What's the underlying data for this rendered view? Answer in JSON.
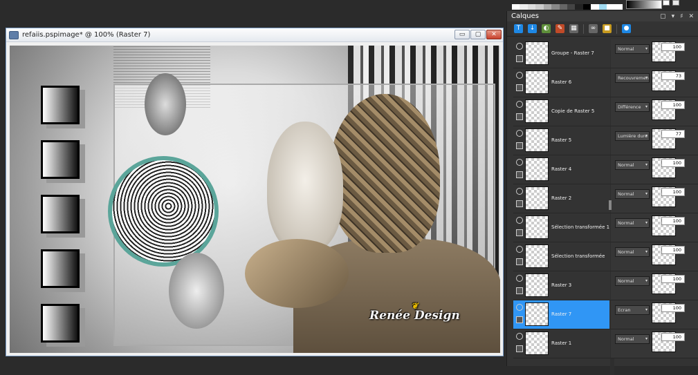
{
  "document_window": {
    "title": "refaiis.pspimage* @ 100% (Raster 7)",
    "buttons": {
      "minimize": "▭",
      "restore": "▢",
      "close": "✕"
    }
  },
  "watermark": {
    "text": "Renée Design",
    "bee": "❦"
  },
  "layers_panel": {
    "title": "Calques",
    "controls": [
      "▢",
      "▾",
      "♯",
      "✕"
    ],
    "toolbar_icons": [
      "new-raster-layer-icon",
      "new-vector-layer-icon",
      "new-adjustment-layer-icon",
      "new-mask-icon",
      "delete-layer-icon",
      "link-layers-icon",
      "lock-icon",
      "layer-styles-icon"
    ],
    "layers": [
      {
        "name": "Groupe - Raster 7",
        "blend": "Normal",
        "opacity": "100",
        "selected": false
      },
      {
        "name": "Raster 6",
        "blend": "Recouvrement",
        "opacity": "73",
        "selected": false
      },
      {
        "name": "Copie de Raster 5",
        "blend": "Différence",
        "opacity": "100",
        "selected": false
      },
      {
        "name": "Raster 5",
        "blend": "Lumière dure",
        "opacity": "77",
        "selected": false
      },
      {
        "name": "Raster 4",
        "blend": "Normal",
        "opacity": "100",
        "selected": false
      },
      {
        "name": "Raster 2",
        "blend": "Normal",
        "opacity": "100",
        "selected": false
      },
      {
        "name": "Sélection transformée 1",
        "blend": "Normal",
        "opacity": "100",
        "selected": false
      },
      {
        "name": "Sélection transformée",
        "blend": "Normal",
        "opacity": "100",
        "selected": false
      },
      {
        "name": "Raster 3",
        "blend": "Normal",
        "opacity": "100",
        "selected": false
      },
      {
        "name": "Raster 7",
        "blend": "Ecran",
        "opacity": "100",
        "selected": true
      },
      {
        "name": "Raster 1",
        "blend": "Normal",
        "opacity": "100",
        "selected": false
      }
    ]
  },
  "colors": {
    "selection": "#3096f5",
    "panel_bg": "#333333",
    "orb_accent": "#5ba59a"
  }
}
